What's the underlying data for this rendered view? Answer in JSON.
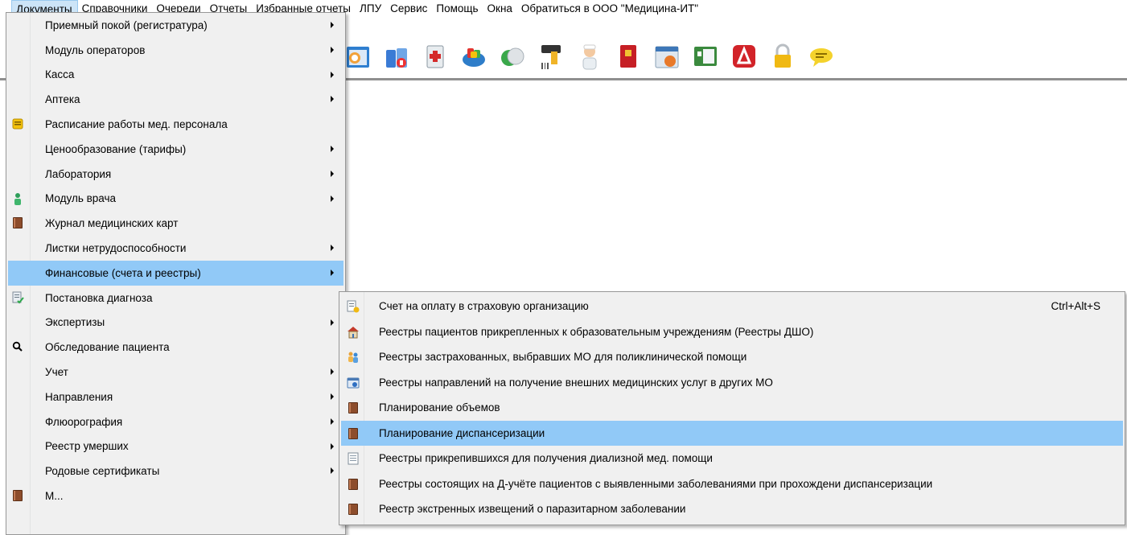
{
  "menubar": {
    "items": [
      {
        "label": "Документы"
      },
      {
        "label": "Справочники"
      },
      {
        "label": "Очереди"
      },
      {
        "label": "Отчеты"
      },
      {
        "label": "Избранные отчеты"
      },
      {
        "label": "ЛПУ"
      },
      {
        "label": "Сервис"
      },
      {
        "label": "Помощь"
      },
      {
        "label": "Окна"
      },
      {
        "label": "Обратиться в ООО \"Медицина-ИТ\""
      }
    ]
  },
  "toolbar": {
    "icons": [
      "doctor-schedule-icon",
      "pharmacy-icon",
      "medical-kit-icon",
      "med-shop-icon",
      "pills-icon",
      "barcode-scanner-icon",
      "nurse-icon",
      "passport-icon",
      "calendar-icon",
      "registry-icon",
      "acrobat-icon",
      "lock-icon",
      "message-icon"
    ]
  },
  "documents_menu": {
    "items": [
      {
        "label": "Приемный покой (регистратура)",
        "submenu": true,
        "icon": null
      },
      {
        "label": "Модуль операторов",
        "submenu": true,
        "icon": null
      },
      {
        "label": "Касса",
        "submenu": true,
        "icon": null
      },
      {
        "label": "Аптека",
        "submenu": true,
        "icon": null
      },
      {
        "label": "Расписание работы мед. персонала",
        "submenu": false,
        "icon": "schedule-icon"
      },
      {
        "label": "Ценообразование (тарифы)",
        "submenu": true,
        "icon": null
      },
      {
        "label": "Лаборатория",
        "submenu": true,
        "icon": null
      },
      {
        "label": "Модуль врача",
        "submenu": true,
        "icon": "doctor-icon"
      },
      {
        "label": "Журнал медицинских карт",
        "submenu": false,
        "icon": "book-icon"
      },
      {
        "label": "Листки нетрудоспособности",
        "submenu": true,
        "icon": null
      },
      {
        "label": "Финансовые (счета и реестры)",
        "submenu": true,
        "icon": null,
        "highlighted": true
      },
      {
        "label": "Постановка диагноза",
        "submenu": false,
        "icon": "diagnosis-icon"
      },
      {
        "label": "Экспертизы",
        "submenu": true,
        "icon": null
      },
      {
        "label": "Обследование пациента",
        "submenu": false,
        "icon": "search-icon"
      },
      {
        "label": "Учет",
        "submenu": true,
        "icon": null
      },
      {
        "label": "Направления",
        "submenu": true,
        "icon": null
      },
      {
        "label": "Флюорография",
        "submenu": true,
        "icon": null
      },
      {
        "label": "Реестр умерших",
        "submenu": true,
        "icon": null
      },
      {
        "label": "Родовые сертификаты",
        "submenu": true,
        "icon": null
      },
      {
        "label": "М...",
        "submenu": false,
        "icon": "book-icon"
      }
    ]
  },
  "finance_submenu": {
    "items": [
      {
        "label": "Счет на оплату в страховую организацию",
        "shortcut": "Ctrl+Alt+S",
        "icon": "invoice-icon"
      },
      {
        "label": "Реестры пациентов прикрепленных к образовательным учреждениям (Реестры ДШО)",
        "shortcut": "",
        "icon": "school-icon"
      },
      {
        "label": "Реестры застрахованных, выбравших МО для поликлинической помощи",
        "shortcut": "",
        "icon": "people-icon"
      },
      {
        "label": "Реестры направлений на получение внешних медицинских услуг в других МО",
        "shortcut": "",
        "icon": "referral-icon"
      },
      {
        "label": "Планирование объемов",
        "shortcut": "",
        "icon": "book-icon"
      },
      {
        "label": "Планирование диспансеризации",
        "shortcut": "",
        "icon": "book-icon",
        "highlighted": true
      },
      {
        "label": "Реестры прикрепившихся для получения диализной мед. помощи",
        "shortcut": "",
        "icon": "document-icon"
      },
      {
        "label": "Реестры состоящих на Д-учёте пациентов с выявленными заболеваниями при прохождени диспансеризации",
        "shortcut": "",
        "icon": "book-icon"
      },
      {
        "label": "Реестр экстренных извещений о паразитарном заболевании",
        "shortcut": "",
        "icon": "book-icon"
      }
    ]
  },
  "colors": {
    "menu_bg": "#f0f0f0",
    "highlight": "#91c9f7",
    "menubar_active": "#cce4f7"
  }
}
